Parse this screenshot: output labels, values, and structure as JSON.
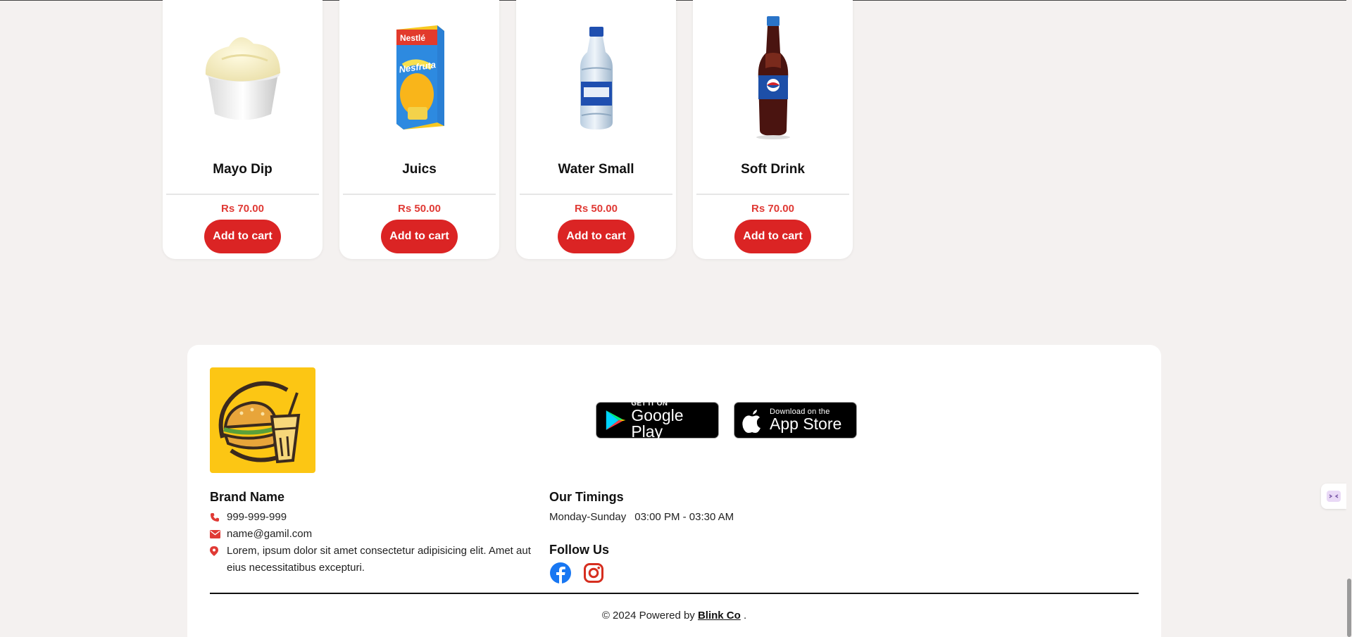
{
  "products": [
    {
      "name": "Mayo Dip",
      "price": "Rs 70.00",
      "button": "Add to cart",
      "image": "mayo-dip-image"
    },
    {
      "name": "Juics",
      "price": "Rs 50.00",
      "button": "Add to cart",
      "image": "juice-box-image"
    },
    {
      "name": "Water Small",
      "price": "Rs 50.00",
      "button": "Add to cart",
      "image": "water-bottle-image"
    },
    {
      "name": "Soft Drink",
      "price": "Rs 70.00",
      "button": "Add to cart",
      "image": "soft-drink-image"
    }
  ],
  "juice_pack": {
    "brand": "Nestlé",
    "product": "Nesfruta"
  },
  "footer": {
    "brand_name": "Brand Name",
    "phone": "999-999-999",
    "email": "name@gamil.com",
    "address": "Lorem, ipsum dolor sit amet consectetur adipisicing elit. Amet aut eius necessitatibus excepturi.",
    "timings_heading": "Our Timings",
    "timings_days": "Monday-Sunday",
    "timings_hours": "03:00 PM - 03:30 AM",
    "follow_heading": "Follow Us",
    "google_play_small": "GET IT ON",
    "google_play_big": "Google Play",
    "app_store_small": "Download on the",
    "app_store_big": "App Store",
    "copyright_prefix": "© 2024 Powered by",
    "copyright_link": "Blink Co",
    "copyright_suffix": "."
  },
  "colors": {
    "accent": "#db2424",
    "price": "#e03a35",
    "logo_bg": "#fcc614",
    "page_bg": "#f4f1f0",
    "facebook": "#1877f2",
    "instagram": "#d62e1f"
  }
}
